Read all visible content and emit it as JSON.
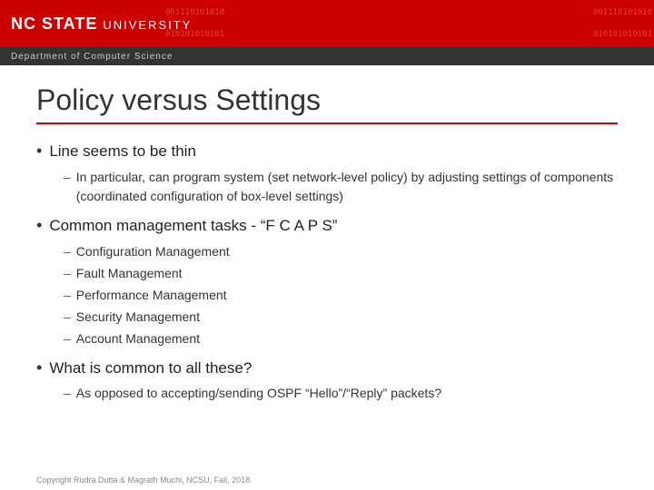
{
  "header": {
    "logo_ncstate": "NC STATE",
    "logo_university": "UNIVERSITY",
    "dept": "Department of Computer Science",
    "binary1": "001110101010",
    "binary2": "010101010101"
  },
  "slide": {
    "title": "Policy versus Settings",
    "bullets": [
      {
        "id": "bullet1",
        "text": "Line seems to be thin",
        "sub_items": [
          "In particular, can program system (set network-level policy) by adjusting settings of components (coordinated configuration of box-level settings)"
        ]
      },
      {
        "id": "bullet2",
        "text": "Common management tasks - “F C A P S”",
        "sub_items": [
          "Configuration Management",
          "Fault Management",
          "Performance Management",
          "Security Management",
          "Account Management"
        ]
      },
      {
        "id": "bullet3",
        "text": "What is common to all these?",
        "sub_items": [
          "As opposed to accepting/sending OSPF “Hello”/“Reply” packets?"
        ]
      }
    ]
  },
  "footer": {
    "text": "Copyright Rudra Dutta & Magrath Muchi, NCSU, Fall, 2018"
  }
}
